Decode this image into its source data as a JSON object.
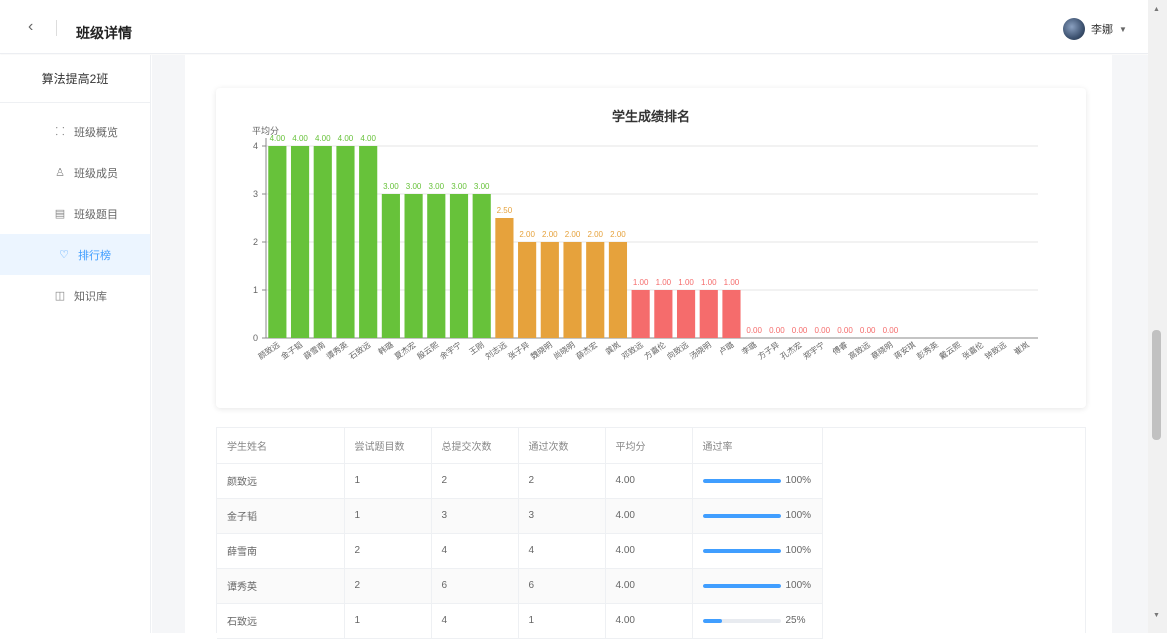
{
  "header": {
    "back_icon": "chevron-left-icon",
    "title": "班级详情",
    "user_name": "李娜"
  },
  "sidebar": {
    "class_name": "算法提高2班",
    "items": [
      {
        "label": "班级概览",
        "icon": "grid-icon",
        "glyph": "⸬"
      },
      {
        "label": "班级成员",
        "icon": "user-icon",
        "glyph": "♙"
      },
      {
        "label": "班级题目",
        "icon": "document-icon",
        "glyph": "▤"
      },
      {
        "label": "排行榜",
        "icon": "trophy-icon",
        "glyph": "♡",
        "active": true
      },
      {
        "label": "知识库",
        "icon": "book-icon",
        "glyph": "◫"
      }
    ]
  },
  "colors": {
    "green": "#67c23a",
    "orange": "#e6a23c",
    "red": "#f56c6c",
    "accent": "#409eff"
  },
  "chart_data": {
    "type": "bar",
    "title": "学生成绩排名",
    "ylabel": "平均分",
    "ylim": [
      0,
      4
    ],
    "yticks": [
      0,
      1,
      2,
      3,
      4
    ],
    "categories": [
      "颜致远",
      "金子韬",
      "薛雪南",
      "谭秀英",
      "石致远",
      "韩璐",
      "夏杰宏",
      "殷云熙",
      "余宇宁",
      "王刚",
      "刘志远",
      "张子异",
      "魏晓明",
      "尚晓明",
      "薛杰宏",
      "龚岚",
      "邓致远",
      "方嘉伦",
      "向致远",
      "汤晓明",
      "卢璐",
      "李璐",
      "方子异",
      "孔杰宏",
      "郑宇宁",
      "傅睿",
      "高致远",
      "蔡晓明",
      "蒋安琪",
      "彭秀英",
      "戴云熙",
      "张嘉伦",
      "钟致远",
      "崔岚"
    ],
    "values": [
      4,
      4,
      4,
      4,
      4,
      3,
      3,
      3,
      3,
      3,
      2.5,
      2,
      2,
      2,
      2,
      2,
      1,
      1,
      1,
      1,
      1,
      0,
      0,
      0,
      0,
      0,
      0,
      0,
      0,
      0,
      0,
      0,
      0,
      0
    ],
    "value_labels": [
      "4.00",
      "4.00",
      "4.00",
      "4.00",
      "4.00",
      "3.00",
      "3.00",
      "3.00",
      "3.00",
      "3.00",
      "2.50",
      "2.00",
      "2.00",
      "2.00",
      "2.00",
      "2.00",
      "1.00",
      "1.00",
      "1.00",
      "1.00",
      "1.00",
      "0.00",
      "0.00",
      "0.00",
      "0.00",
      "0.00",
      "0.00",
      "0.00"
    ],
    "color_rule": ">=3 green, >=2 orange, >0 red"
  },
  "table": {
    "headers": [
      "学生姓名",
      "尝试题目数",
      "总提交次数",
      "通过次数",
      "平均分",
      "通过率"
    ],
    "rows": [
      {
        "name": "颜致远",
        "tried": "1",
        "submits": "2",
        "passes": "2",
        "avg": "4.00",
        "rate": 1.0,
        "rate_label": "100%"
      },
      {
        "name": "金子韬",
        "tried": "1",
        "submits": "3",
        "passes": "3",
        "avg": "4.00",
        "rate": 1.0,
        "rate_label": "100%"
      },
      {
        "name": "薛雪南",
        "tried": "2",
        "submits": "4",
        "passes": "4",
        "avg": "4.00",
        "rate": 1.0,
        "rate_label": "100%"
      },
      {
        "name": "谭秀英",
        "tried": "2",
        "submits": "6",
        "passes": "6",
        "avg": "4.00",
        "rate": 1.0,
        "rate_label": "100%"
      },
      {
        "name": "石致远",
        "tried": "1",
        "submits": "4",
        "passes": "1",
        "avg": "4.00",
        "rate": 0.25,
        "rate_label": "25%"
      }
    ]
  }
}
